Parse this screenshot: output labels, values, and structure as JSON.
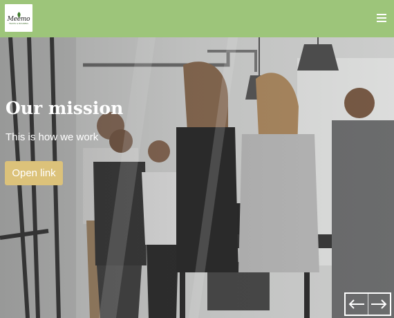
{
  "header": {
    "logo": {
      "word": "Meemo",
      "tagline": "TRAVEL & BUSINESS"
    },
    "menu_icon": "hamburger-menu-icon",
    "background_color": "#9dc57a"
  },
  "hero": {
    "title": "Our mission",
    "subtitle": "This is how we work",
    "cta_label": "Open link",
    "cta_color": "#dcc27a",
    "image": "photo-of-team-in-office",
    "slider_controls": {
      "prev_icon": "arrow-left-icon",
      "next_icon": "arrow-right-icon"
    }
  }
}
